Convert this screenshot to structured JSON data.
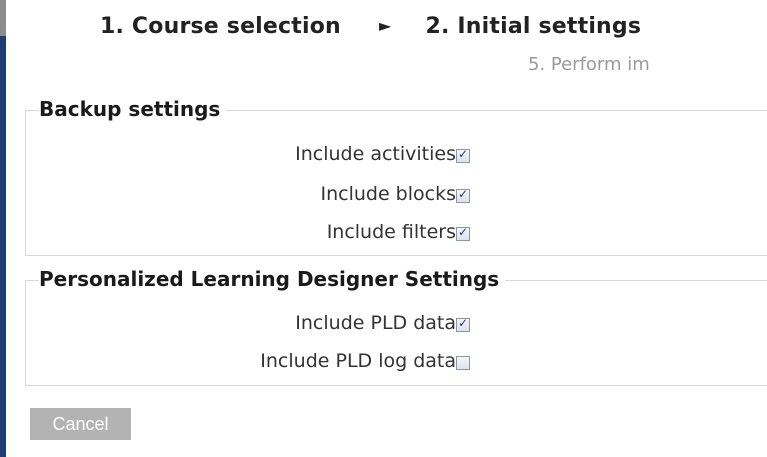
{
  "stepper": {
    "step1": "1. Course selection",
    "separator": "►",
    "step2": "2. Initial settings",
    "step5": "5. Perform im"
  },
  "backup_settings": {
    "legend": "Backup settings",
    "options": [
      {
        "label": "Include activities",
        "checked": true
      },
      {
        "label": "Include blocks",
        "checked": true
      },
      {
        "label": "Include filters",
        "checked": true
      }
    ]
  },
  "pld_settings": {
    "legend": "Personalized Learning Designer Settings",
    "options": [
      {
        "label": "Include PLD data",
        "checked": true
      },
      {
        "label": "Include PLD log data",
        "checked": false
      }
    ]
  },
  "actions": {
    "cancel_label": "Cancel"
  }
}
